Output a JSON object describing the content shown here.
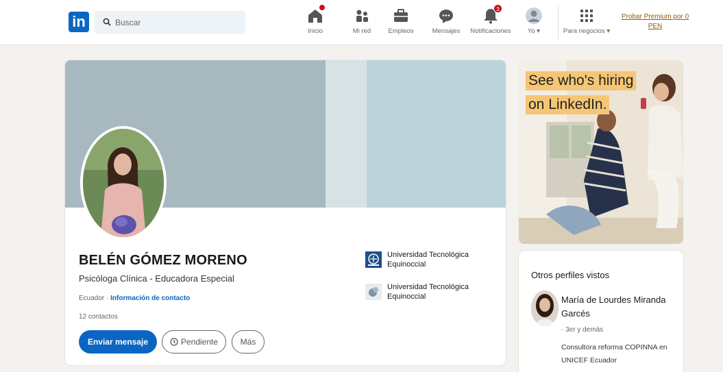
{
  "nav": {
    "logo": "in",
    "search_placeholder": "Buscar",
    "items": [
      {
        "label": "Inicio",
        "badge": ""
      },
      {
        "label": "Mi red",
        "badge": ""
      },
      {
        "label": "Empleos",
        "badge": ""
      },
      {
        "label": "Mensajes",
        "badge": ""
      },
      {
        "label": "Notificaciones",
        "badge": "3"
      },
      {
        "label": "Yo ▾",
        "badge": ""
      },
      {
        "label": "Para negocios ▾",
        "badge": ""
      }
    ],
    "premium": "Probar Premium por 0 PEN"
  },
  "profile": {
    "name": "BELÉN GÓMEZ MORENO",
    "headline": "Psicóloga Clínica - Educadora Especial",
    "location": "Ecuador ·",
    "contact_link": "Información de contacto",
    "connections": "12 contactos",
    "buttons": {
      "message": "Enviar mensaje",
      "pending": "Pendiente",
      "more": "Más"
    },
    "education": [
      {
        "name": "Universidad Tecnológica Equinoccial"
      },
      {
        "name": "Universidad Tecnológica Equinoccial"
      }
    ]
  },
  "ad": {
    "line1": "See who's hiring",
    "line2": "on LinkedIn."
  },
  "others_viewed": {
    "title": "Otros perfiles vistos",
    "person": {
      "name": "María de Lourdes Miranda Garcés",
      "degree": "· 3er y demás",
      "headline": "Consultora reforma COPINNA en UNICEF Ecuador"
    }
  },
  "colors": {
    "brand": "#0a66c2",
    "badge": "#cc1016",
    "premium": "#915907",
    "ad_highlight": "#f5c675"
  }
}
